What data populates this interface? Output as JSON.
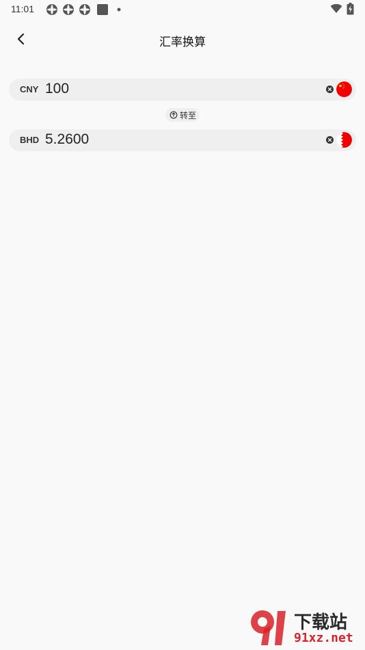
{
  "status_bar": {
    "time": "11:01",
    "left_icons": [
      "notification-icon",
      "notification-icon",
      "notification-icon",
      "app-square-icon",
      "dot-icon"
    ],
    "right_icons": [
      "wifi-icon",
      "battery-charging-icon"
    ]
  },
  "header": {
    "title": "汇率换算",
    "back_icon": "chevron-left-icon"
  },
  "converter": {
    "from": {
      "code": "CNY",
      "amount": "100",
      "flag": "flag-cn-icon",
      "flag_color": "#f20000"
    },
    "swap_label": "转至",
    "to": {
      "code": "BHD",
      "amount": "5.2600",
      "flag": "flag-bh-icon",
      "flag_color": "#f20000"
    }
  },
  "watermark": {
    "text": "下载站",
    "url": "91xz.net",
    "accent": "#d9222a"
  }
}
